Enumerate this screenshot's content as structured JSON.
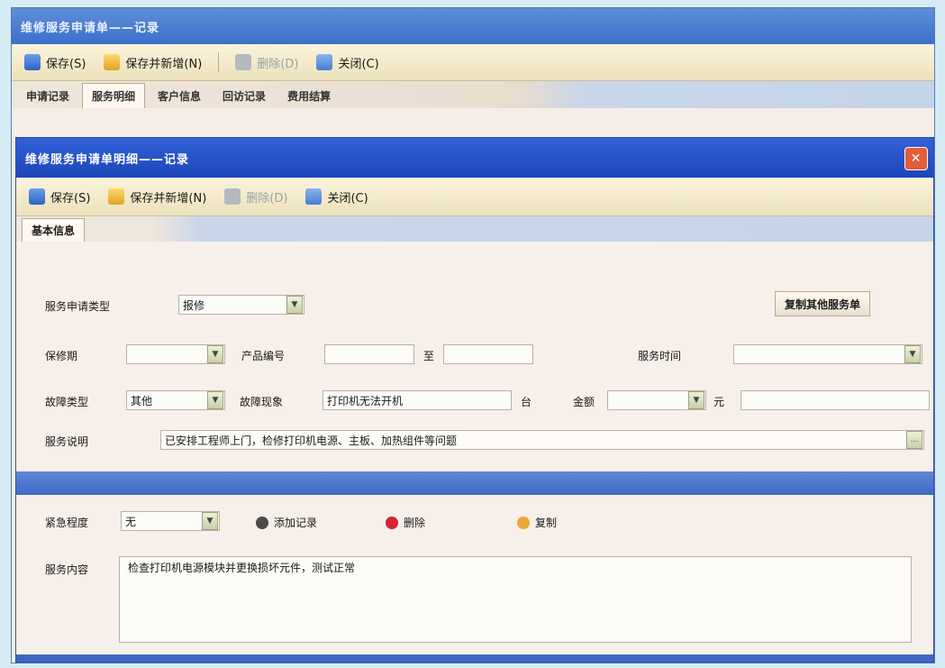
{
  "window": {
    "title": "维修服务申请单——记录"
  },
  "toolbar": {
    "items": [
      {
        "label": "保存(S)",
        "disabled": false
      },
      {
        "label": "保存并新增(N)",
        "disabled": false
      },
      {
        "label": "删除(D)",
        "disabled": true
      },
      {
        "label": "关闭(C)",
        "disabled": false
      }
    ]
  },
  "tabs": [
    "申请记录",
    "服务明细",
    "客户信息",
    "回访记录",
    "费用结算"
  ],
  "dialog": {
    "title": "维修服务申请单明细——记录",
    "close_label": "✕",
    "toolbar": [
      {
        "label": "保存(S)",
        "disabled": false
      },
      {
        "label": "保存并新增(N)",
        "disabled": false
      },
      {
        "label": "删除(D)",
        "disabled": true
      },
      {
        "label": "关闭(C)",
        "disabled": false
      }
    ],
    "form_tab": "基本信息"
  },
  "form": {
    "service_type_label": "服务申请类型",
    "service_type_value": "报修",
    "copy_button": "复制其他服务单",
    "warranty_label": "保修期",
    "warranty_value": "",
    "product_no_label": "产品编号",
    "to_label": "至",
    "product_no_to": "",
    "service_time_label": "服务时间",
    "service_time_value": "",
    "fault_type_label": "故障类型",
    "fault_type_value": "其他",
    "fault_desc_label": "故障现象",
    "fault_desc_value": "打印机无法开机",
    "qty_label": "台",
    "amount_label": "金额",
    "amount_value": "",
    "unit_label": "元",
    "unit_value": "",
    "remark_label": "服务说明",
    "remark_value": "已安排工程师上门，检修打印机电源、主板、加热组件等问题"
  },
  "lower": {
    "priority_label": "紧急程度",
    "priority_value": "无",
    "btn_add": "添加记录",
    "btn_delete": "删除",
    "btn_copy": "复制",
    "notes_label": "服务内容",
    "notes_value": "检查打印机电源模块并更换损坏元件，测试正常"
  },
  "colors": {
    "titlebar": "#3c6fcb",
    "dialog_titlebar": "#1d46b9",
    "close": "#e35d3b",
    "background": "#f7efe9"
  }
}
